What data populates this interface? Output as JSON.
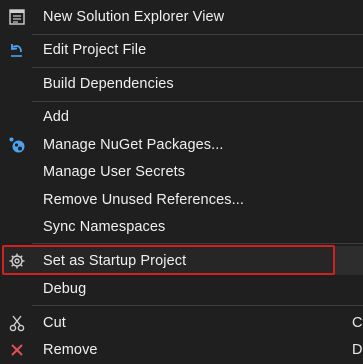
{
  "menu": {
    "items": {
      "new_solution_explorer_view": {
        "label": "New Solution Explorer View",
        "icon": "solution-explorer-icon"
      },
      "edit_project_file": {
        "label": "Edit Project File",
        "icon": "edit-arrow-icon"
      },
      "build_dependencies": {
        "label": "Build Dependencies"
      },
      "add": {
        "label": "Add"
      },
      "manage_nuget": {
        "label": "Manage NuGet Packages...",
        "icon": "nuget-icon"
      },
      "manage_user_secrets": {
        "label": "Manage User Secrets"
      },
      "remove_unused_references": {
        "label": "Remove Unused References..."
      },
      "sync_namespaces": {
        "label": "Sync Namespaces"
      },
      "set_as_startup": {
        "label": "Set as Startup Project",
        "icon": "gear-icon"
      },
      "debug": {
        "label": "Debug"
      },
      "cut": {
        "label": "Cut",
        "shortcut": "Ct",
        "icon": "scissors-icon"
      },
      "remove": {
        "label": "Remove",
        "shortcut": "D",
        "icon": "remove-x-icon"
      }
    },
    "colors": {
      "background": "#1f1f1f",
      "highlight": "#2d2d2d",
      "annotation_border": "#d02020",
      "accent_blue": "#4aa3f0",
      "remove_red": "#e05050"
    }
  }
}
